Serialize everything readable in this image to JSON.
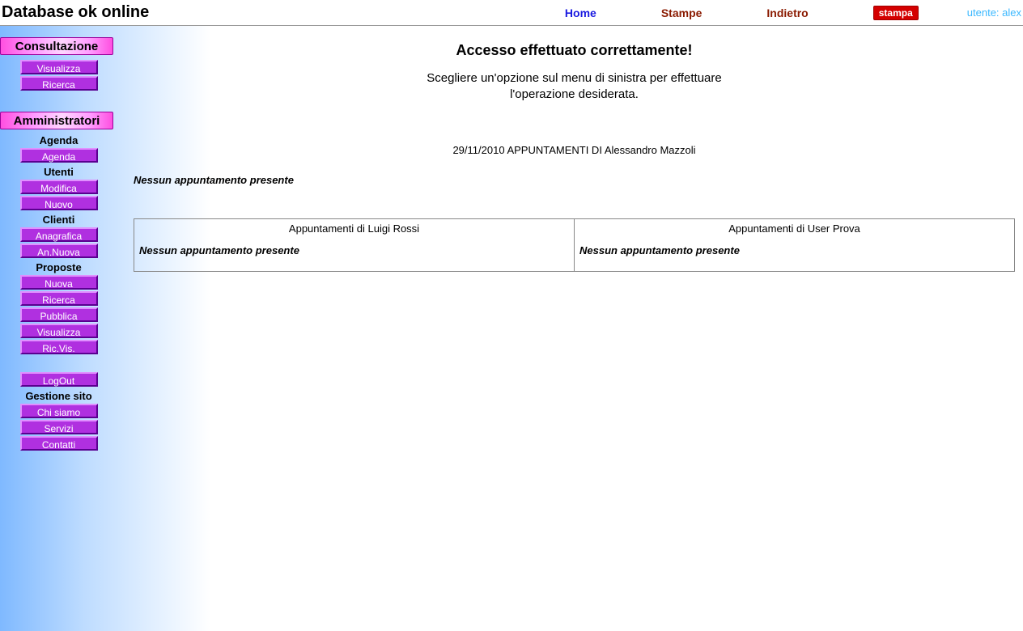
{
  "header": {
    "site_title": "Database ok online",
    "nav_home": "Home",
    "nav_stampe": "Stampe",
    "nav_indietro": "Indietro",
    "stampa_btn": "stampa",
    "user_label": "utente: alex"
  },
  "sidebar": {
    "section_consultazione": "Consultazione",
    "btn_visualizza": "Visualizza",
    "btn_ricerca": "Ricerca",
    "section_amministratori": "Amministratori",
    "lbl_agenda": "Agenda",
    "btn_agenda": "Agenda",
    "lbl_utenti": "Utenti",
    "btn_modifica": "Modifica",
    "btn_nuovo": "Nuovo",
    "lbl_clienti": "Clienti",
    "btn_anagrafica": "Anagrafica",
    "btn_an_nuova": "An.Nuova",
    "lbl_proposte": "Proposte",
    "btn_p_nuova": "Nuova",
    "btn_p_ricerca": "Ricerca",
    "btn_p_pubblica": "Pubblica",
    "btn_p_visualizza": "Visualizza",
    "btn_p_ricvis": "Ric.Vis.",
    "btn_logout": "LogOut",
    "lbl_gestione": "Gestione sito",
    "btn_chi_siamo": "Chi siamo",
    "btn_servizi": "Servizi",
    "btn_contatti": "Contatti"
  },
  "main": {
    "headline": "Accesso effettuato correttamente!",
    "subline1": "Scegliere un'opzione sul menu di sinistra per effettuare",
    "subline2": "l'operazione desiderata.",
    "appts_title": "29/11/2010 APPUNTAMENTI DI Alessandro Mazzoli",
    "no_appt": "Nessun appuntamento presente",
    "col1_title": "Appuntamenti di Luigi Rossi",
    "col1_msg": "Nessun appuntamento presente",
    "col2_title": "Appuntamenti di User Prova",
    "col2_msg": "Nessun appuntamento presente"
  }
}
